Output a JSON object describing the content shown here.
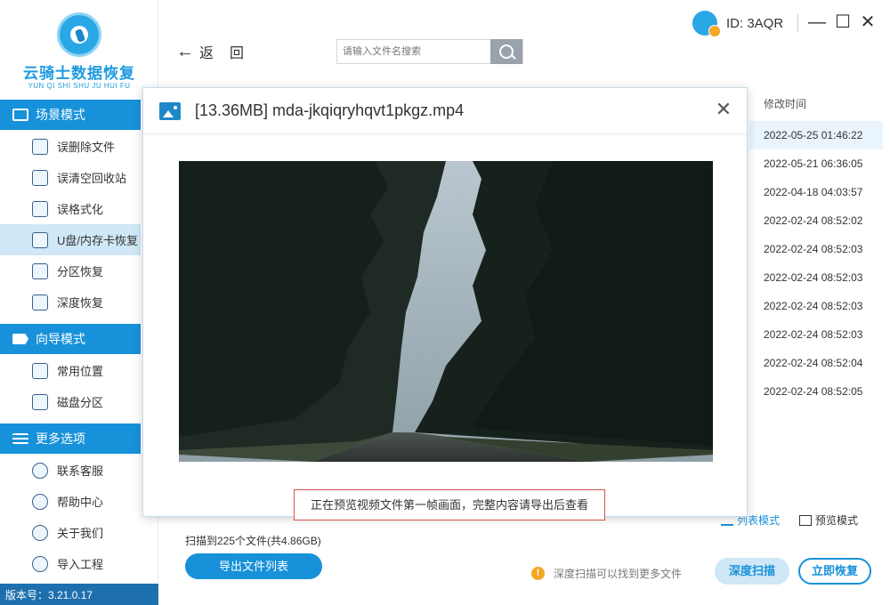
{
  "app": {
    "title": "云骑士数据恢复",
    "subtitle": "YUN QI SHI SHU JU HUI FU",
    "version": "版本号：3.21.0.17"
  },
  "sidebar": {
    "sections": [
      {
        "label": "场景模式",
        "items": [
          {
            "label": "误删除文件",
            "icon": "file-delete-icon"
          },
          {
            "label": "误清空回收站",
            "icon": "recycle-bin-icon"
          },
          {
            "label": "误格式化",
            "icon": "format-icon"
          },
          {
            "label": "U盘/内存卡恢复",
            "icon": "usb-card-icon",
            "active": true
          },
          {
            "label": "分区恢复",
            "icon": "partition-icon"
          },
          {
            "label": "深度恢复",
            "icon": "deep-recover-icon"
          }
        ]
      },
      {
        "label": "向导模式",
        "items": [
          {
            "label": "常用位置",
            "icon": "windows-icon"
          },
          {
            "label": "磁盘分区",
            "icon": "disk-icon"
          }
        ]
      },
      {
        "label": "更多选项",
        "items": [
          {
            "label": "联系客服",
            "icon": "support-icon"
          },
          {
            "label": "帮助中心",
            "icon": "help-icon"
          },
          {
            "label": "关于我们",
            "icon": "info-icon"
          },
          {
            "label": "导入工程",
            "icon": "import-icon"
          }
        ]
      }
    ]
  },
  "topbar": {
    "back_label": "返",
    "refresh_label": "回",
    "search_placeholder": "请输入文件名搜索",
    "user_id": "ID: 3AQR"
  },
  "window_controls": {
    "minimize": "—",
    "maximize": "☐",
    "close": "✕"
  },
  "file_list": {
    "column_modified": "修改时间",
    "times": [
      "2022-05-25 01:46:22",
      "2022-05-21 06:36:05",
      "2022-04-18 04:03:57",
      "2022-02-24 08:52:02",
      "2022-02-24 08:52:03",
      "2022-02-24 08:52:03",
      "2022-02-24 08:52:03",
      "2022-02-24 08:52:03",
      "2022-02-24 08:52:04",
      "2022-02-24 08:52:05"
    ]
  },
  "bottom": {
    "scan_info": "扫描到225个文件(共4.86GB)",
    "list_mode": "列表模式",
    "preview_mode": "预览模式",
    "export_list": "导出文件列表",
    "tip": "深度扫描可以找到更多文件",
    "deep_scan": "深度扫描",
    "recover_now": "立即恢复"
  },
  "preview_modal": {
    "title": "[13.36MB] mda-jkqiqryhqvt1pkgz.mp4",
    "caption": "正在预览视频文件第一帧画面，完整内容请导出后查看"
  },
  "colors": {
    "accent": "#1791d9",
    "sidebar_active": "#cfe7f6",
    "version_bar": "#1e6fad",
    "warning": "#f5a623"
  }
}
